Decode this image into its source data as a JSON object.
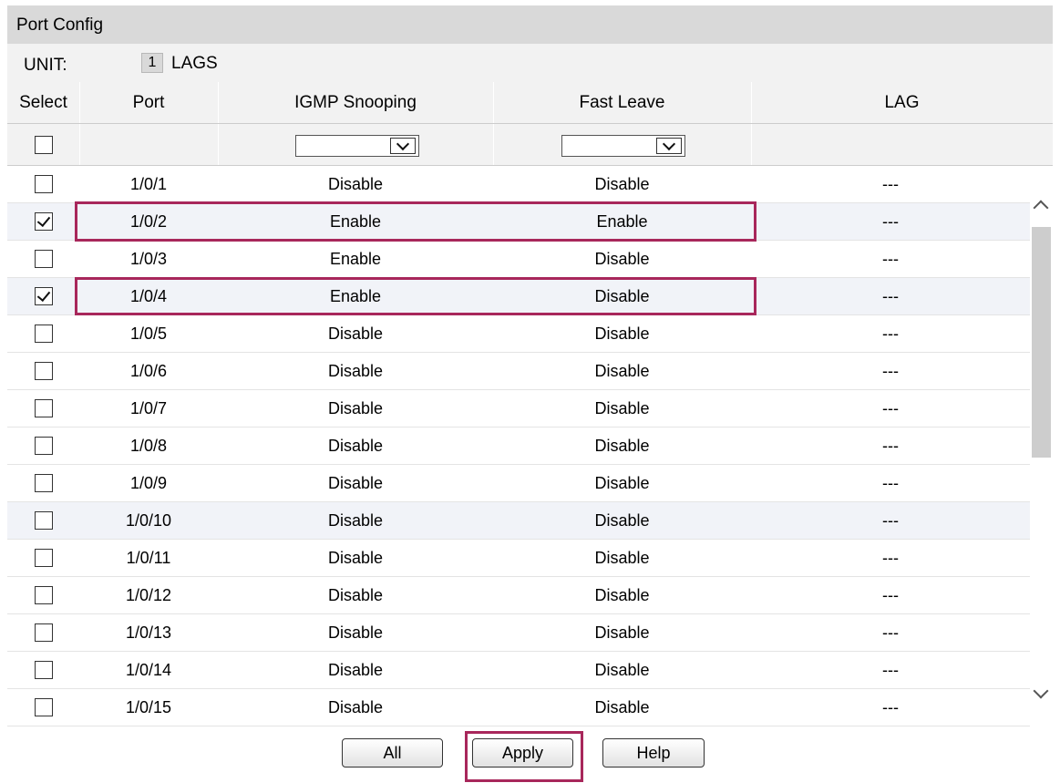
{
  "panel": {
    "title": "Port Config",
    "unit_label": "UNIT:",
    "unit_value": "1",
    "lags_label": "LAGS"
  },
  "table": {
    "headers": {
      "select": "Select",
      "port": "Port",
      "igmp": "IGMP Snooping",
      "fast_leave": "Fast Leave",
      "lag": "LAG"
    },
    "filter": {
      "select_all_checked": false,
      "igmp_selected": "",
      "fast_leave_selected": ""
    },
    "rows": [
      {
        "port": "1/0/1",
        "igmp": "Disable",
        "fast_leave": "Disable",
        "lag": "---",
        "checked": false
      },
      {
        "port": "1/0/2",
        "igmp": "Enable",
        "fast_leave": "Enable",
        "lag": "---",
        "checked": true
      },
      {
        "port": "1/0/3",
        "igmp": "Enable",
        "fast_leave": "Disable",
        "lag": "---",
        "checked": false
      },
      {
        "port": "1/0/4",
        "igmp": "Enable",
        "fast_leave": "Disable",
        "lag": "---",
        "checked": true
      },
      {
        "port": "1/0/5",
        "igmp": "Disable",
        "fast_leave": "Disable",
        "lag": "---",
        "checked": false
      },
      {
        "port": "1/0/6",
        "igmp": "Disable",
        "fast_leave": "Disable",
        "lag": "---",
        "checked": false
      },
      {
        "port": "1/0/7",
        "igmp": "Disable",
        "fast_leave": "Disable",
        "lag": "---",
        "checked": false
      },
      {
        "port": "1/0/8",
        "igmp": "Disable",
        "fast_leave": "Disable",
        "lag": "---",
        "checked": false
      },
      {
        "port": "1/0/9",
        "igmp": "Disable",
        "fast_leave": "Disable",
        "lag": "---",
        "checked": false
      },
      {
        "port": "1/0/10",
        "igmp": "Disable",
        "fast_leave": "Disable",
        "lag": "---",
        "checked": false
      },
      {
        "port": "1/0/11",
        "igmp": "Disable",
        "fast_leave": "Disable",
        "lag": "---",
        "checked": false
      },
      {
        "port": "1/0/12",
        "igmp": "Disable",
        "fast_leave": "Disable",
        "lag": "---",
        "checked": false
      },
      {
        "port": "1/0/13",
        "igmp": "Disable",
        "fast_leave": "Disable",
        "lag": "---",
        "checked": false
      },
      {
        "port": "1/0/14",
        "igmp": "Disable",
        "fast_leave": "Disable",
        "lag": "---",
        "checked": false
      },
      {
        "port": "1/0/15",
        "igmp": "Disable",
        "fast_leave": "Disable",
        "lag": "---",
        "checked": false
      }
    ]
  },
  "buttons": {
    "all": "All",
    "apply": "Apply",
    "help": "Help"
  },
  "colors": {
    "highlight": "#a8275b",
    "header_bg": "#d9d9d9",
    "alt_row": "#f1f3f8"
  }
}
